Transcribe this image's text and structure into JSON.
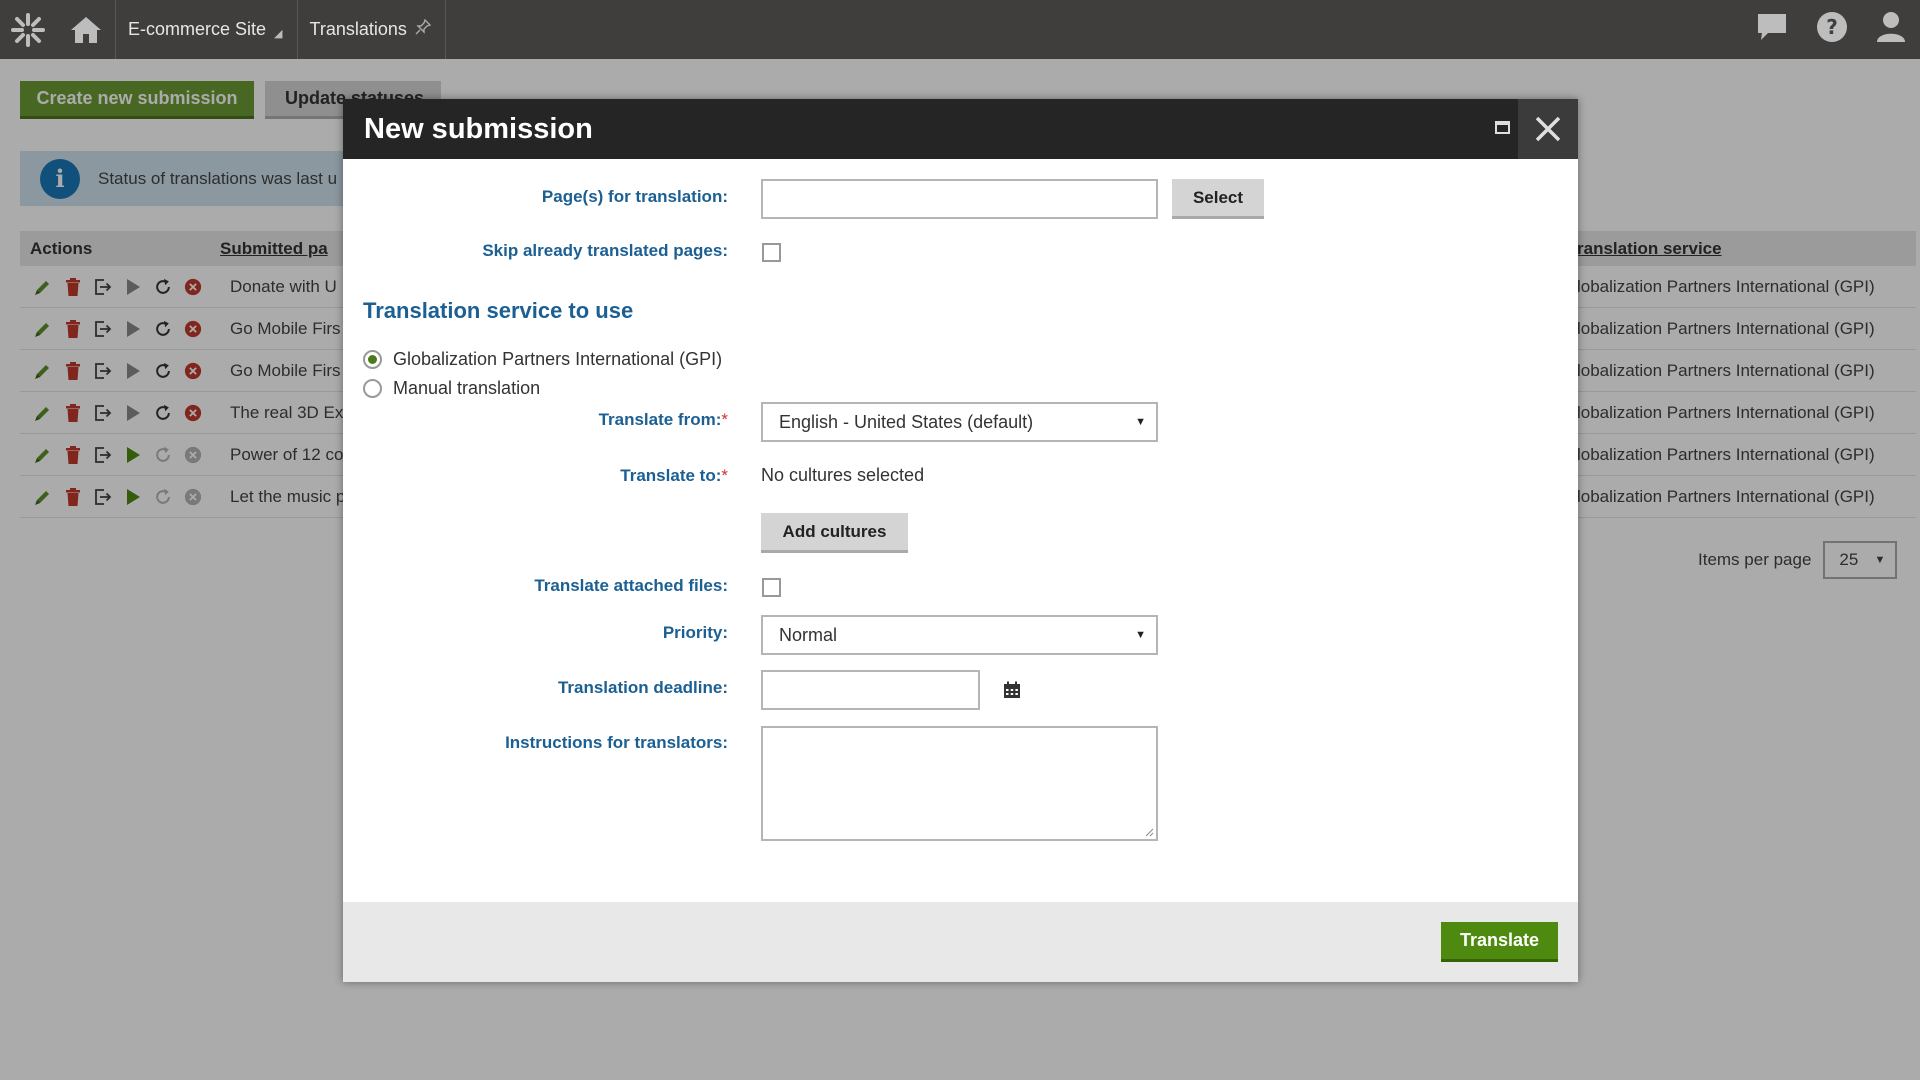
{
  "topbar": {
    "site_name": "E-commerce Site",
    "app_name": "Translations"
  },
  "main": {
    "create_button": "Create new submission",
    "update_button": "Update statuses",
    "info_text": "Status of translations was last u",
    "grid": {
      "headers": {
        "actions": "Actions",
        "submitted": "Submitted pa",
        "service": "ranslation service"
      },
      "rows": [
        {
          "name": "Donate with U",
          "service": "lobalization Partners International (GPI)",
          "active": false
        },
        {
          "name": "Go Mobile Firs",
          "service": "lobalization Partners International (GPI)",
          "active": false
        },
        {
          "name": "Go Mobile Firs",
          "service": "lobalization Partners International (GPI)",
          "active": false
        },
        {
          "name": "The real 3D Ex",
          "service": "lobalization Partners International (GPI)",
          "active": false
        },
        {
          "name": "Power of 12 co",
          "service": "lobalization Partners International (GPI)",
          "active": true
        },
        {
          "name": "Let the music p",
          "service": "lobalization Partners International (GPI)",
          "active": true
        }
      ]
    },
    "pager": {
      "label": "Items per page",
      "value": "25"
    }
  },
  "dialog": {
    "title": "New submission",
    "pages_label": "Page(s) for translation:",
    "pages_value": "",
    "select_button": "Select",
    "skip_label": "Skip already translated pages:",
    "section_title": "Translation service to use",
    "services": [
      {
        "label": "Globalization Partners International (GPI)",
        "selected": true
      },
      {
        "label": "Manual translation",
        "selected": false
      }
    ],
    "translate_from_label": "Translate from:",
    "translate_from_value": "English - United States (default)",
    "translate_to_label": "Translate to:",
    "translate_to_value": "No cultures selected",
    "add_cultures_button": "Add cultures",
    "attached_label": "Translate attached files:",
    "priority_label": "Priority:",
    "priority_value": "Normal",
    "deadline_label": "Translation deadline:",
    "deadline_value": "",
    "instructions_label": "Instructions for translators:",
    "instructions_value": "",
    "required_marker": "*",
    "translate_button": "Translate"
  },
  "colors": {
    "accent_blue": "#1c5f93",
    "primary_green": "#4f8a10",
    "topbar": "#403e3d"
  }
}
